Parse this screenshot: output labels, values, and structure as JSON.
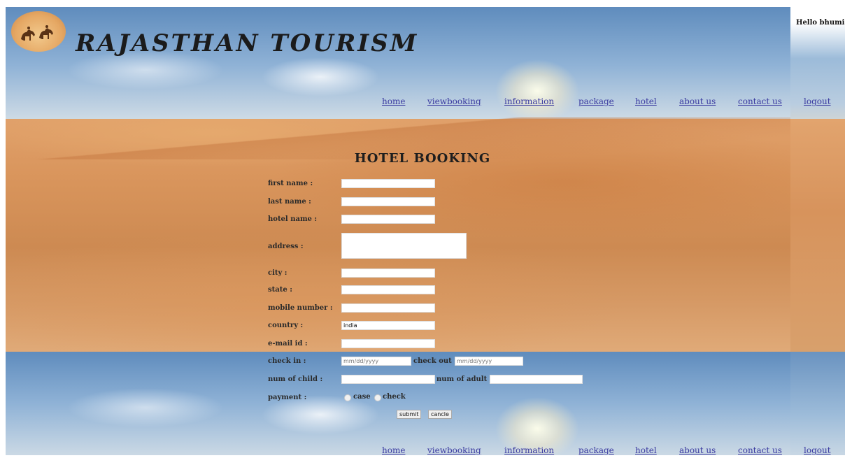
{
  "header": {
    "site_title": "RAJASTHAN TOURISM",
    "greeting": "Hello bhumi"
  },
  "nav": {
    "items": [
      {
        "id": "home",
        "label": "home"
      },
      {
        "id": "viewbooking",
        "label": "viewbooking"
      },
      {
        "id": "information",
        "label": "information"
      },
      {
        "id": "package",
        "label": "package"
      },
      {
        "id": "hotel",
        "label": "hotel"
      },
      {
        "id": "aboutus",
        "label": "about us"
      },
      {
        "id": "contactus",
        "label": "contact us"
      },
      {
        "id": "logout",
        "label": "logout"
      }
    ]
  },
  "form": {
    "title": "HOTEL BOOKING",
    "labels": {
      "first_name": "first name :",
      "last_name": "last name :",
      "hotel_name": "hotel name :",
      "address": "address :",
      "city": "city :",
      "state": "state :",
      "mobile_number": "mobile number :",
      "country": "country :",
      "email": "e-mail id :",
      "check_in": "check in :",
      "check_out": "check out :",
      "num_child": "num of child :",
      "num_adult": "num of adult :",
      "payment": "payment :"
    },
    "values": {
      "country": "india"
    },
    "date_placeholder": "mm/dd/yyyy",
    "payment_options": {
      "case": "case",
      "check": "check"
    },
    "buttons": {
      "submit": "submit",
      "cancel": "cancle"
    }
  },
  "colors": {
    "link": "#3a3aa0",
    "title": "#1b1b1b"
  }
}
